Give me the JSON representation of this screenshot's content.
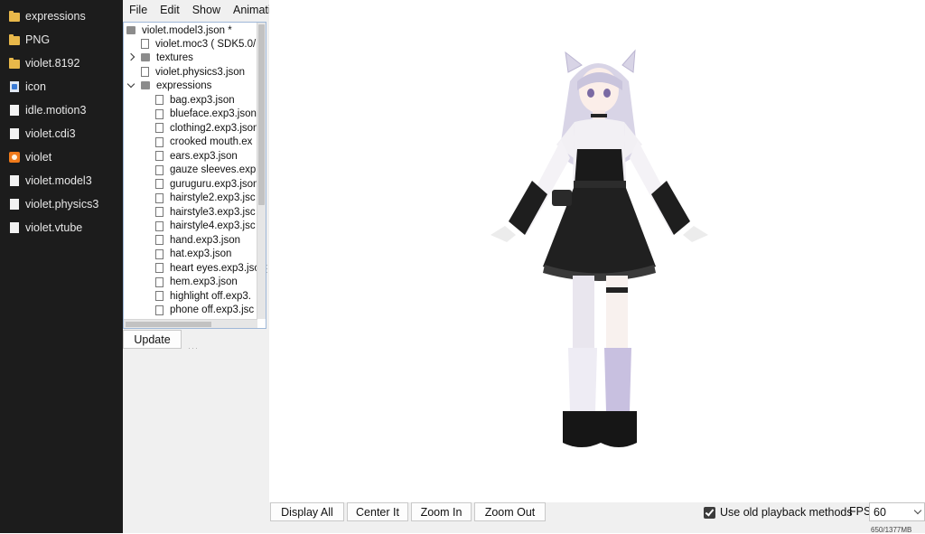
{
  "explorer": {
    "items": [
      {
        "label": "expressions",
        "icon": "folder-icon"
      },
      {
        "label": "PNG",
        "icon": "folder-icon"
      },
      {
        "label": "violet.8192",
        "icon": "folder-icon"
      },
      {
        "label": "icon",
        "icon": "image-file-icon"
      },
      {
        "label": "idle.motion3",
        "icon": "file-icon"
      },
      {
        "label": "violet.cdi3",
        "icon": "file-icon"
      },
      {
        "label": "violet",
        "icon": "app-icon"
      },
      {
        "label": "violet.model3",
        "icon": "file-icon"
      },
      {
        "label": "violet.physics3",
        "icon": "file-icon"
      },
      {
        "label": "violet.vtube",
        "icon": "file-icon"
      }
    ]
  },
  "menu": {
    "file": "File",
    "edit": "Edit",
    "show": "Show",
    "animation": "Animation"
  },
  "tree": {
    "root": "violet.model3.json *",
    "moc": "violet.moc3 ( SDK5.0/",
    "textures": "textures",
    "physics": "violet.physics3.json",
    "expressions_folder": "expressions",
    "expressions": [
      "bag.exp3.json",
      "blueface.exp3.json",
      "clothing2.exp3.json",
      "crooked mouth.ex",
      "ears.exp3.json",
      "gauze sleeves.exp.",
      "guruguru.exp3.json",
      "hairstyle2.exp3.jsc",
      "hairstyle3.exp3.jsc",
      "hairstyle4.exp3.jsc",
      "hand.exp3.json",
      "hat.exp3.json",
      "heart eyes.exp3.jsc",
      "hem.exp3.json",
      "highlight off.exp3.",
      "phone off.exp3.jsc"
    ]
  },
  "buttons": {
    "update": "Update",
    "display_all": "Display All",
    "center_it": "Center It",
    "zoom_in": "Zoom In",
    "zoom_out": "Zoom Out"
  },
  "playback": {
    "label": "Use old playback methods",
    "checked": true
  },
  "fps": {
    "label": "FPS",
    "value": "60"
  },
  "memory": "650/1377MB"
}
